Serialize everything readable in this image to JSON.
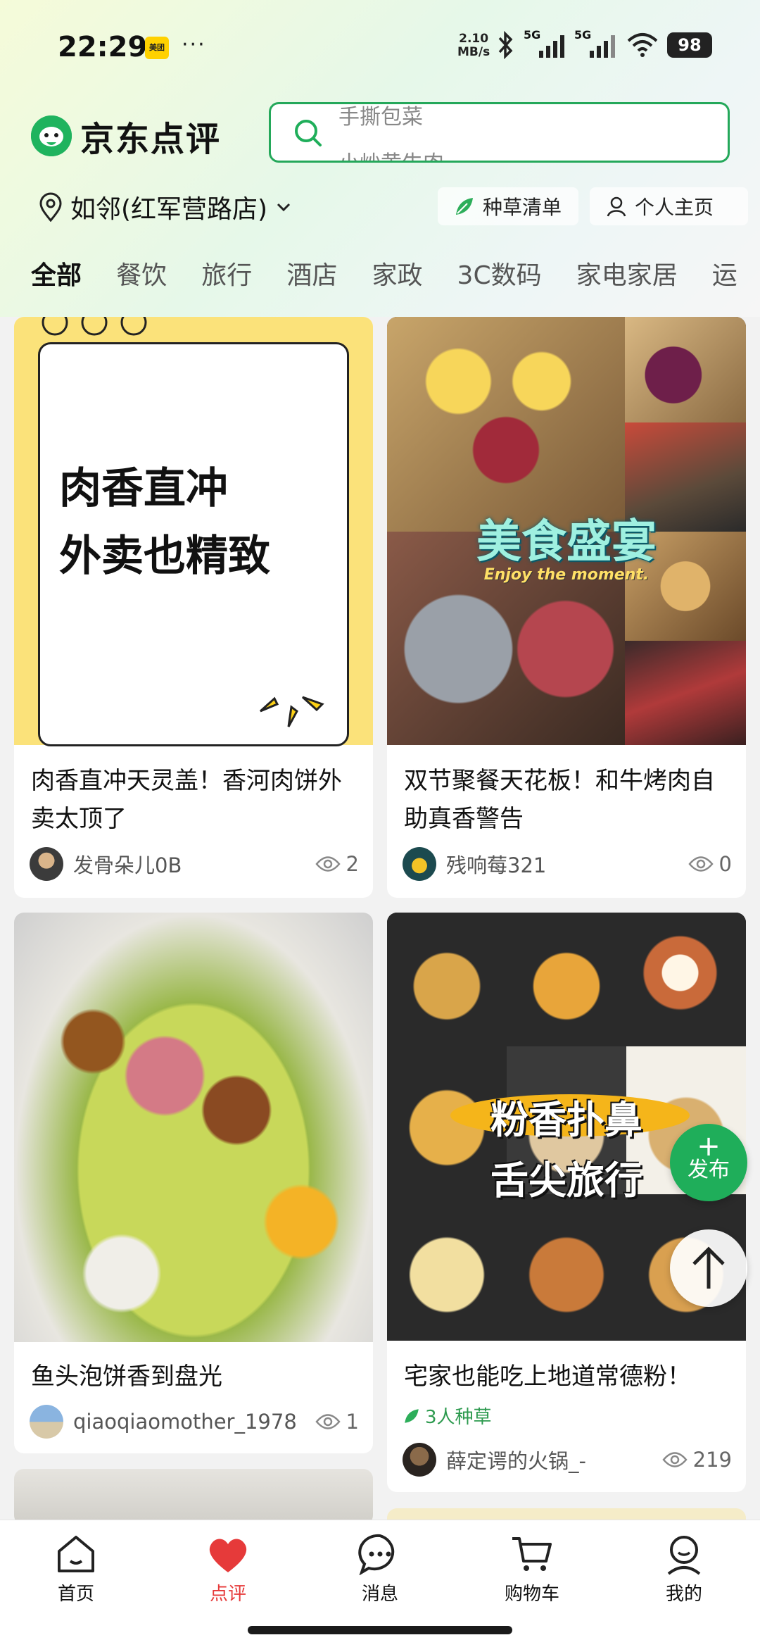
{
  "status_bar": {
    "time": "22:29",
    "badge": "美团",
    "dots": "···",
    "net_speed_value": "2.10",
    "net_speed_unit": "MB/s",
    "signal_1": "5G",
    "signal_2": "5G",
    "battery": "98"
  },
  "header": {
    "logo_text": "京东点评",
    "search_hint_prev": "手撕包菜",
    "search_hint_next": "小炒黄牛肉"
  },
  "location": {
    "label": "如邻(红军营路店)",
    "grass_list": "种草清单",
    "personal_home": "个人主页"
  },
  "tabs": [
    "全部",
    "餐饮",
    "旅行",
    "酒店",
    "家政",
    "3C数码",
    "家电家居",
    "运"
  ],
  "feed": {
    "cards": [
      {
        "promo_line1": "肉香直冲",
        "promo_line2": "外卖也精致",
        "title": "肉香直冲天灵盖！香河肉饼外卖太顶了",
        "author": "发骨朵儿0B",
        "views": "2"
      },
      {
        "overlay_title": "美食盛宴",
        "overlay_sub": "Enjoy the moment.",
        "title": "双节聚餐天花板！和牛烤肉自助真香警告",
        "author": "残响莓321",
        "views": "0"
      },
      {
        "title": "鱼头泡饼香到盘光",
        "author": "qiaoqiaomother_1978",
        "views": "1"
      },
      {
        "overlay_line1": "粉香扑鼻",
        "overlay_line2": "舌尖旅行",
        "title": "宅家也能吃上地道常德粉！",
        "grass_count": "3人种草",
        "author": "薛定谔的火锅_-",
        "views": "219"
      }
    ]
  },
  "fab": {
    "post_plus": "+",
    "post_label": "发布"
  },
  "bottom_nav": [
    {
      "label": "首页",
      "icon": "home-icon"
    },
    {
      "label": "点评",
      "icon": "heart-icon"
    },
    {
      "label": "消息",
      "icon": "message-icon"
    },
    {
      "label": "购物车",
      "icon": "cart-icon"
    },
    {
      "label": "我的",
      "icon": "profile-icon"
    }
  ],
  "colors": {
    "brand_green": "#24a85a",
    "active_red": "#e63a3a",
    "promo_yellow": "#fbe27a"
  }
}
